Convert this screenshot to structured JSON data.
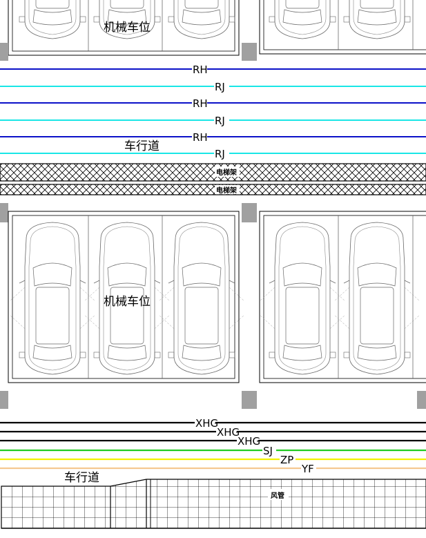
{
  "labels": {
    "parking_top": "机械车位",
    "parking_middle": "机械车位",
    "lane_top": "车行道",
    "lane_bottom": "车行道",
    "cable_tray_1": "电梯架",
    "cable_tray_2": "电梯架",
    "duct": "风管"
  },
  "pipes_top": [
    {
      "code": "RH",
      "color": "#0a10c8"
    },
    {
      "code": "RJ",
      "color": "#19e6e6"
    },
    {
      "code": "RH",
      "color": "#0a10c8"
    },
    {
      "code": "RJ",
      "color": "#19e6e6"
    },
    {
      "code": "RH",
      "color": "#0a10c8"
    },
    {
      "code": "RJ",
      "color": "#19e6e6"
    }
  ],
  "pipes_bottom": [
    {
      "code": "XHG",
      "color": "#000000"
    },
    {
      "code": "XHG",
      "color": "#000000"
    },
    {
      "code": "XHG",
      "color": "#000000"
    },
    {
      "code": "SJ",
      "color": "#22cc22"
    },
    {
      "code": "ZP",
      "color": "#f2f200"
    },
    {
      "code": "YF",
      "color": "#f5c890"
    }
  ],
  "colors": {
    "line_work": "#555555",
    "column": "#a0a0a0"
  }
}
